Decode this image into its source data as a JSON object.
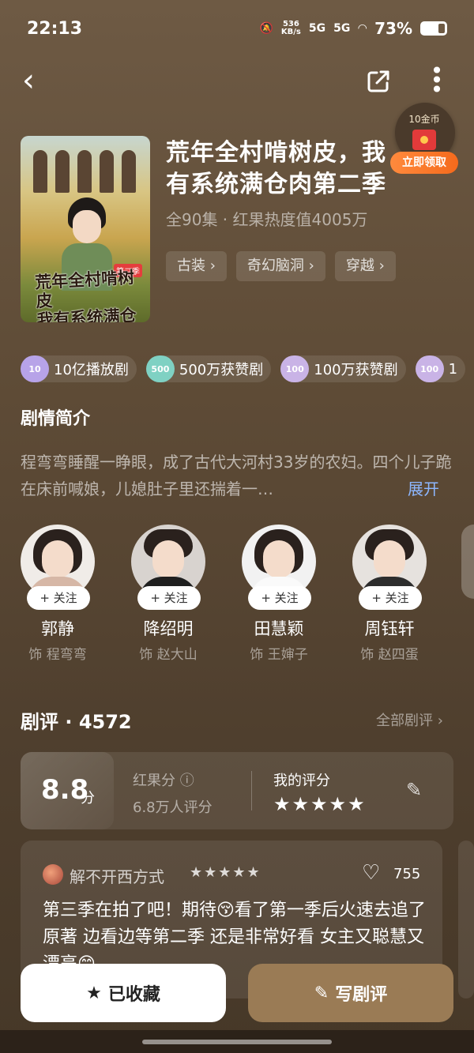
{
  "status_bar": {
    "time": "22:13",
    "speed_value": "536",
    "speed_unit": "KB/s",
    "signal1": "5G",
    "signal2": "5G",
    "battery": "73%"
  },
  "nav": {
    "back_icon": "‹",
    "more_icon": "⋮"
  },
  "coin": {
    "label": "10金币",
    "button": "立即领取"
  },
  "poster": {
    "title_line1": "荒年全村啃树皮",
    "title_line2": "我有系统满仓肉",
    "badge": "第二季"
  },
  "show": {
    "title": "荒年全村啃树皮，我有系统满仓肉第二季",
    "meta": "全90集 · 红果热度值4005万",
    "tags": [
      "古装 ›",
      "奇幻脑洞 ›",
      "穿越 ›"
    ]
  },
  "badges": [
    {
      "icon": "10",
      "label": "10亿播放剧",
      "color": "#b7a3e8"
    },
    {
      "icon": "500",
      "label": "500万获赞剧",
      "color": "#7fd1c3"
    },
    {
      "icon": "100",
      "label": "100万获赞剧",
      "color": "#c9b3e6"
    },
    {
      "icon": "100",
      "label": "1",
      "color": "#c9b3e6"
    }
  ],
  "synopsis": {
    "title": "剧情简介",
    "text": "程弯弯睡醒一睁眼，成了古代大河村33岁的农妇。四个儿子跪在床前喊娘，儿媳肚子里还揣着一…",
    "expand": "展开"
  },
  "cast": [
    {
      "name": "郭静",
      "role": "饰 程弯弯",
      "follow": "+ 关注"
    },
    {
      "name": "降绍明",
      "role": "饰 赵大山",
      "follow": "+ 关注"
    },
    {
      "name": "田慧颖",
      "role": "饰 王婶子",
      "follow": "+ 关注"
    },
    {
      "name": "周钰轩",
      "role": "饰 赵四蛋",
      "follow": "+ 关注"
    }
  ],
  "reviews": {
    "header": "剧评 · 4572",
    "all_link": "全部剧评 ›",
    "score_value": "8.8",
    "score_unit": "分",
    "score_label": "红果分 ⓘ",
    "score_count": "6.8万人评分",
    "my_rating_label": "我的评分",
    "my_stars": "★★★★★",
    "first": {
      "user": "解不开西方式",
      "stars": "★★★★★",
      "likes": "755",
      "text": "第三季在拍了吧！期待😚看了第一季后火速去追了原著 边看边等第二季 还是非常好看 女主又聪慧又漂亮😊"
    }
  },
  "bottom": {
    "collect_label": "已收藏",
    "write_label": "写剧评"
  },
  "icons": {
    "back": "back-icon",
    "share": "share-icon",
    "more": "more-icon",
    "edit": "pencil-icon",
    "like": "heart-icon",
    "collect": "star-icon",
    "write": "pencil-icon"
  }
}
